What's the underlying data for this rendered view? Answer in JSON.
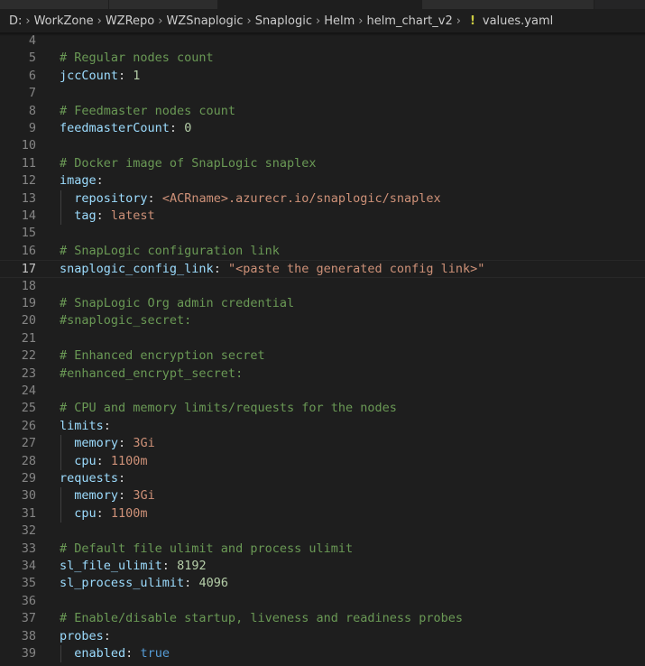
{
  "breadcrumb": {
    "items": [
      "D:",
      "WorkZone",
      "WZRepo",
      "WZSnaplogic",
      "Snaplogic",
      "Helm",
      "helm_chart_v2"
    ],
    "file_icon": "!",
    "file": "values.yaml"
  },
  "editor": {
    "current_line": 17,
    "lines": [
      {
        "n": "4",
        "indent": 0,
        "tokens": []
      },
      {
        "n": "5",
        "indent": 0,
        "tokens": [
          {
            "t": "c",
            "v": "# Regular nodes count"
          }
        ]
      },
      {
        "n": "6",
        "indent": 0,
        "tokens": [
          {
            "t": "k",
            "v": "jccCount"
          },
          {
            "t": "p",
            "v": ": "
          },
          {
            "t": "n",
            "v": "1"
          }
        ]
      },
      {
        "n": "7",
        "indent": 0,
        "tokens": []
      },
      {
        "n": "8",
        "indent": 0,
        "tokens": [
          {
            "t": "c",
            "v": "# Feedmaster nodes count"
          }
        ]
      },
      {
        "n": "9",
        "indent": 0,
        "tokens": [
          {
            "t": "k",
            "v": "feedmasterCount"
          },
          {
            "t": "p",
            "v": ": "
          },
          {
            "t": "n",
            "v": "0"
          }
        ]
      },
      {
        "n": "10",
        "indent": 0,
        "tokens": []
      },
      {
        "n": "11",
        "indent": 0,
        "tokens": [
          {
            "t": "c",
            "v": "# Docker image of SnapLogic snaplex"
          }
        ]
      },
      {
        "n": "12",
        "indent": 0,
        "tokens": [
          {
            "t": "k",
            "v": "image"
          },
          {
            "t": "p",
            "v": ":"
          }
        ]
      },
      {
        "n": "13",
        "indent": 1,
        "tokens": [
          {
            "t": "k",
            "v": "repository"
          },
          {
            "t": "p",
            "v": ": "
          },
          {
            "t": "s",
            "v": "<ACRname>.azurecr.io/snaplogic/snaplex"
          }
        ]
      },
      {
        "n": "14",
        "indent": 1,
        "tokens": [
          {
            "t": "k",
            "v": "tag"
          },
          {
            "t": "p",
            "v": ": "
          },
          {
            "t": "s",
            "v": "latest"
          }
        ]
      },
      {
        "n": "15",
        "indent": 0,
        "tokens": []
      },
      {
        "n": "16",
        "indent": 0,
        "tokens": [
          {
            "t": "c",
            "v": "# SnapLogic configuration link"
          }
        ]
      },
      {
        "n": "17",
        "indent": 0,
        "tokens": [
          {
            "t": "k",
            "v": "snaplogic_config_link"
          },
          {
            "t": "p",
            "v": ": "
          },
          {
            "t": "s",
            "v": "\"<paste the generated config link>\""
          }
        ]
      },
      {
        "n": "18",
        "indent": 0,
        "tokens": []
      },
      {
        "n": "19",
        "indent": 0,
        "tokens": [
          {
            "t": "c",
            "v": "# SnapLogic Org admin credential"
          }
        ]
      },
      {
        "n": "20",
        "indent": 0,
        "tokens": [
          {
            "t": "c",
            "v": "#snaplogic_secret:"
          }
        ]
      },
      {
        "n": "21",
        "indent": 0,
        "tokens": []
      },
      {
        "n": "22",
        "indent": 0,
        "tokens": [
          {
            "t": "c",
            "v": "# Enhanced encryption secret"
          }
        ]
      },
      {
        "n": "23",
        "indent": 0,
        "tokens": [
          {
            "t": "c",
            "v": "#enhanced_encrypt_secret:"
          }
        ]
      },
      {
        "n": "24",
        "indent": 0,
        "tokens": []
      },
      {
        "n": "25",
        "indent": 0,
        "tokens": [
          {
            "t": "c",
            "v": "# CPU and memory limits/requests for the nodes"
          }
        ]
      },
      {
        "n": "26",
        "indent": 0,
        "tokens": [
          {
            "t": "k",
            "v": "limits"
          },
          {
            "t": "p",
            "v": ":"
          }
        ]
      },
      {
        "n": "27",
        "indent": 1,
        "tokens": [
          {
            "t": "k",
            "v": "memory"
          },
          {
            "t": "p",
            "v": ": "
          },
          {
            "t": "s",
            "v": "3Gi"
          }
        ]
      },
      {
        "n": "28",
        "indent": 1,
        "tokens": [
          {
            "t": "k",
            "v": "cpu"
          },
          {
            "t": "p",
            "v": ": "
          },
          {
            "t": "s",
            "v": "1100m"
          }
        ]
      },
      {
        "n": "29",
        "indent": 0,
        "tokens": [
          {
            "t": "k",
            "v": "requests"
          },
          {
            "t": "p",
            "v": ":"
          }
        ]
      },
      {
        "n": "30",
        "indent": 1,
        "tokens": [
          {
            "t": "k",
            "v": "memory"
          },
          {
            "t": "p",
            "v": ": "
          },
          {
            "t": "s",
            "v": "3Gi"
          }
        ]
      },
      {
        "n": "31",
        "indent": 1,
        "tokens": [
          {
            "t": "k",
            "v": "cpu"
          },
          {
            "t": "p",
            "v": ": "
          },
          {
            "t": "s",
            "v": "1100m"
          }
        ]
      },
      {
        "n": "32",
        "indent": 0,
        "tokens": []
      },
      {
        "n": "33",
        "indent": 0,
        "tokens": [
          {
            "t": "c",
            "v": "# Default file ulimit and process ulimit"
          }
        ]
      },
      {
        "n": "34",
        "indent": 0,
        "tokens": [
          {
            "t": "k",
            "v": "sl_file_ulimit"
          },
          {
            "t": "p",
            "v": ": "
          },
          {
            "t": "n",
            "v": "8192"
          }
        ]
      },
      {
        "n": "35",
        "indent": 0,
        "tokens": [
          {
            "t": "k",
            "v": "sl_process_ulimit"
          },
          {
            "t": "p",
            "v": ": "
          },
          {
            "t": "n",
            "v": "4096"
          }
        ]
      },
      {
        "n": "36",
        "indent": 0,
        "tokens": []
      },
      {
        "n": "37",
        "indent": 0,
        "tokens": [
          {
            "t": "c",
            "v": "# Enable/disable startup, liveness and readiness probes"
          }
        ]
      },
      {
        "n": "38",
        "indent": 0,
        "tokens": [
          {
            "t": "k",
            "v": "probes"
          },
          {
            "t": "p",
            "v": ":"
          }
        ]
      },
      {
        "n": "39",
        "indent": 1,
        "tokens": [
          {
            "t": "k",
            "v": "enabled"
          },
          {
            "t": "p",
            "v": ": "
          },
          {
            "t": "b",
            "v": "true"
          }
        ]
      }
    ]
  }
}
